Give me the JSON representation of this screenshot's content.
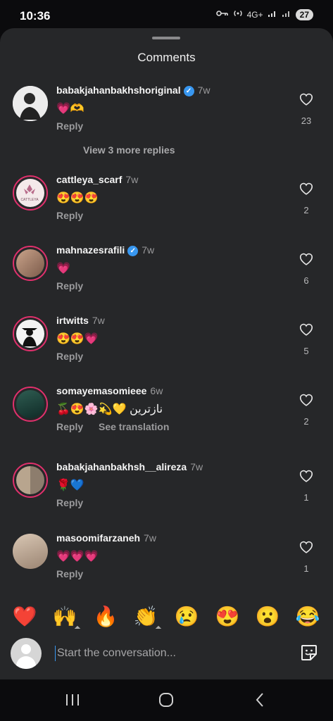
{
  "status": {
    "time": "10:36",
    "network": "4G+",
    "battery": "27"
  },
  "header": {
    "title": "Comments"
  },
  "comments": [
    {
      "username": "babakjahanbakhshoriginal",
      "verified": true,
      "time": "7w",
      "text": "💗🫶",
      "reply": "Reply",
      "likes": "23"
    },
    {
      "username": "cattleya_scarf",
      "verified": false,
      "time": "7w",
      "text": "😍😍😍",
      "reply": "Reply",
      "likes": "2"
    },
    {
      "username": "mahnazesrafili",
      "verified": true,
      "time": "7w",
      "text": "💗",
      "reply": "Reply",
      "likes": "6"
    },
    {
      "username": "irtwitts",
      "verified": false,
      "time": "7w",
      "text": "😍😍💗",
      "reply": "Reply",
      "likes": "5"
    },
    {
      "username": "somayemasomieee",
      "verified": false,
      "time": "6w",
      "text": "🍒😍🌸💫💛 نازترین",
      "reply": "Reply",
      "see_translation": "See translation",
      "likes": "2"
    },
    {
      "username": "babakjahanbakhsh__alireza",
      "verified": false,
      "time": "7w",
      "text": "🌹💙",
      "reply": "Reply",
      "likes": "1"
    },
    {
      "username": "masoomifarzaneh",
      "verified": false,
      "time": "7w",
      "text": "💗💗💗",
      "reply": "Reply",
      "likes": "1"
    }
  ],
  "more_replies": "View 3 more replies",
  "cattleya_logo": "CATTLEYA",
  "reactions": [
    "❤️",
    "🙌",
    "🔥",
    "👏",
    "😢",
    "😍",
    "😮",
    "😂"
  ],
  "composer": {
    "placeholder": "Start the conversation..."
  },
  "icons": {
    "like": "heart-outline-icon",
    "verified": "verified-badge-icon",
    "sticker": "sticker-icon",
    "nav": [
      "recents-icon",
      "home-icon",
      "back-icon"
    ]
  },
  "colors": {
    "background": "#262729",
    "verified": "#3897f0",
    "story_ring": "#e1306c"
  }
}
